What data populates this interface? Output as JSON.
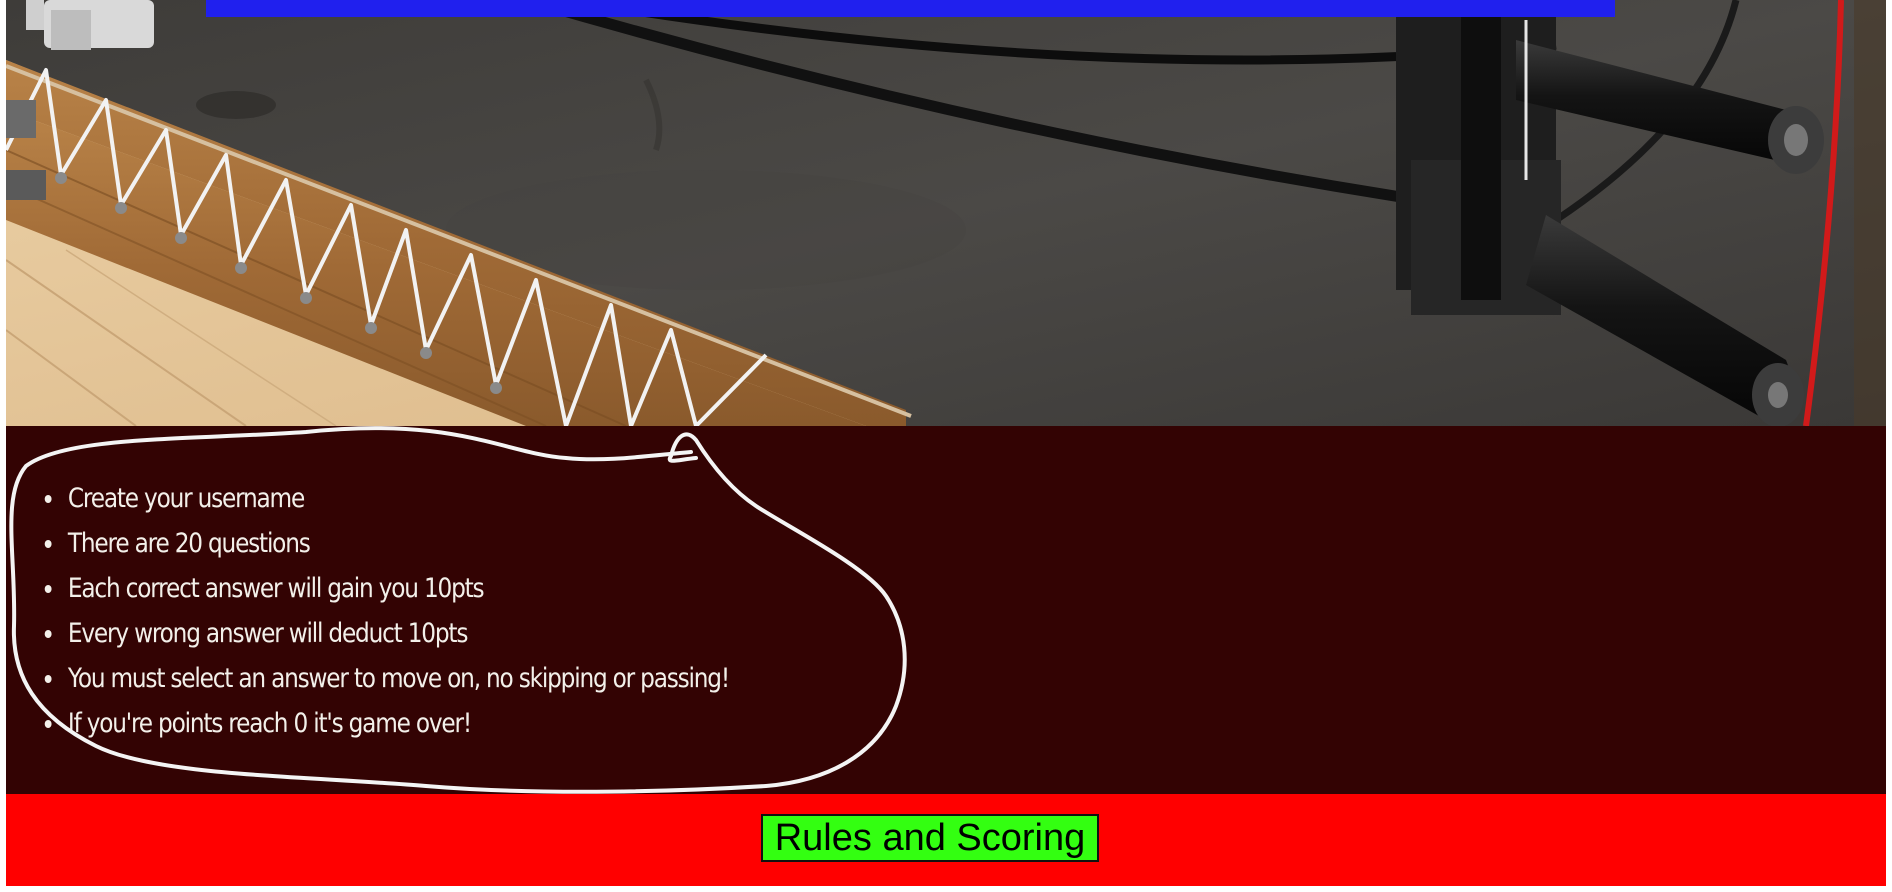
{
  "hero": {
    "image": "boxing-ring-photo",
    "banner_color": "#2020ee"
  },
  "rules": {
    "items": [
      "Create your username",
      "There are 20 questions",
      "Each correct answer will gain you 10pts",
      "Every wrong answer will deduct 10pts",
      "You must select an answer to move on, no skipping or passing!",
      "If you're points reach 0 it's game over!"
    ],
    "panel_color": "#330303",
    "text_color": "#f3f0ea"
  },
  "footer": {
    "button_label": "Rules and Scoring",
    "background_color": "#ff0000",
    "button_color": "#33ff11"
  }
}
